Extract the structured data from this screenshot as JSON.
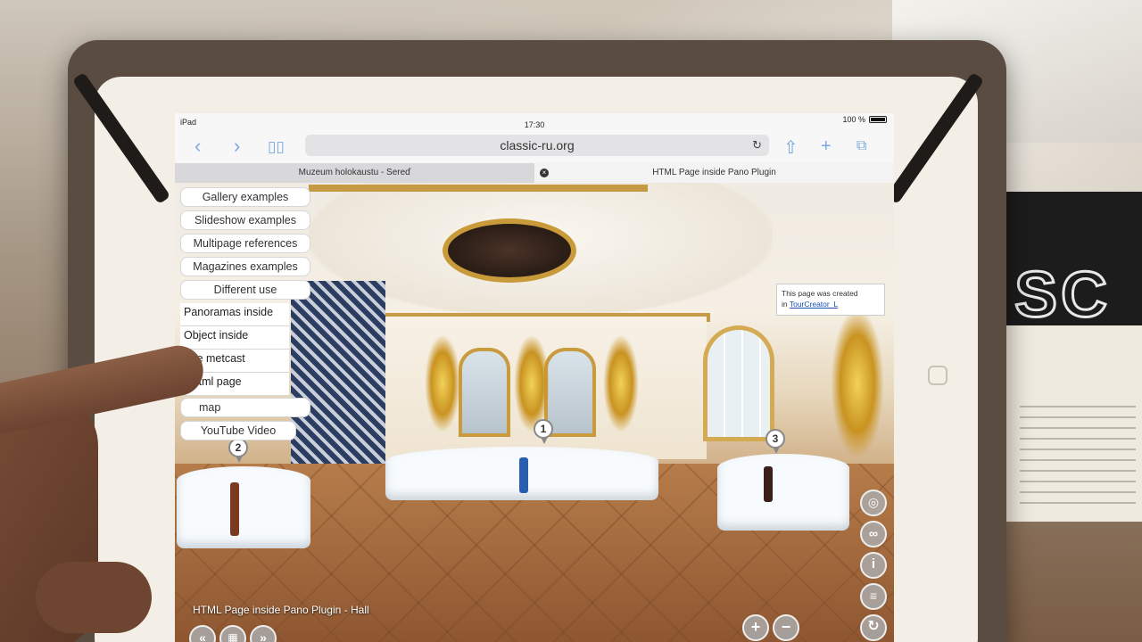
{
  "statusbar": {
    "device": "iPad",
    "time": "17:30",
    "battery": "100 %"
  },
  "toolbar": {
    "back_icon": "chevron-left-icon",
    "forward_icon": "chevron-right-icon",
    "bookmarks_icon": "book-icon",
    "url": "classic-ru.org",
    "reload_icon": "reload-icon",
    "share_icon": "share-icon",
    "new_tab_icon": "plus-icon",
    "tabs_icon": "tabs-icon"
  },
  "tabs": [
    {
      "label": "Muzeum holokaustu - Sereď"
    },
    {
      "label": "HTML Page inside Pano Plugin"
    }
  ],
  "menu": {
    "items": [
      "Gallery examples",
      "Slideshow examples",
      "Multipage references",
      "Magazines examples",
      "Different use"
    ],
    "submenu": [
      "Panoramas inside",
      "Object inside",
      "The metcast",
      "y html page"
    ],
    "after": [
      "map",
      "YouTube Video"
    ]
  },
  "info_box": {
    "text": "This page was created",
    "prefix": "in",
    "link": "TourCreator_L"
  },
  "markers": [
    "1",
    "2",
    "3"
  ],
  "caption": "HTML Page inside Pano Plugin - Hall",
  "controls": {
    "zoom_in": "+",
    "zoom_out": "−"
  },
  "colors": {
    "accent": "#7aa7df",
    "gold": "#c59a45"
  }
}
